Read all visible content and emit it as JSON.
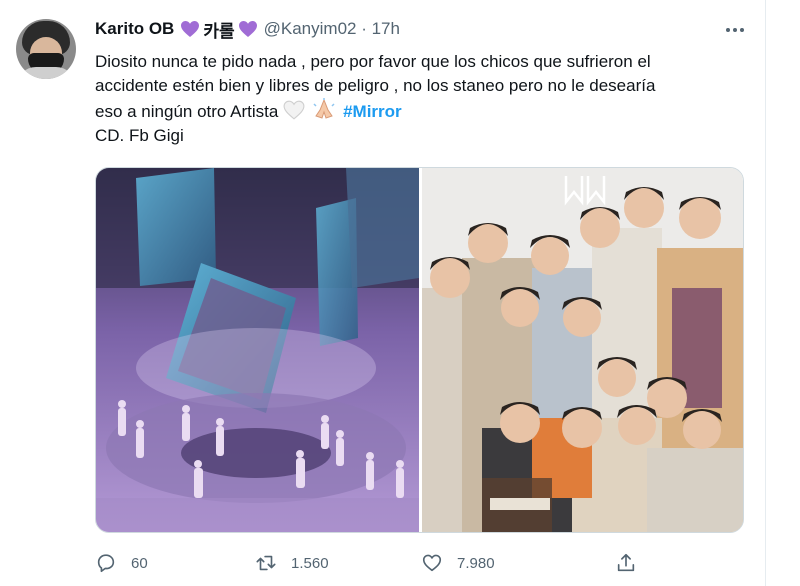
{
  "tweet": {
    "display_name": "Karito OB",
    "name_korean": "카롤",
    "handle_time": "@Kanyim02 · 17h",
    "text_lines": [
      "Diosito nunca te pido nada , pero por favor que los chicos que sufrieron el",
      "accidente estén bien y libres de peligro , no los staneo pero no le desearía",
      "eso a ningún otro Artista"
    ],
    "hashtag": "#Mirror",
    "credit": "CD. Fb Gigi"
  },
  "actions": {
    "replies": "60",
    "retweets": "1.560",
    "likes": "7.980"
  },
  "icons": {
    "more": "more-horizontal-icon",
    "reply": "reply-icon",
    "retweet": "retweet-icon",
    "like": "heart-icon",
    "share": "share-icon",
    "heart_emoji_color": "#9b59b6"
  },
  "colors": {
    "link": "#1d9bf0",
    "secondary_text": "#536471"
  }
}
